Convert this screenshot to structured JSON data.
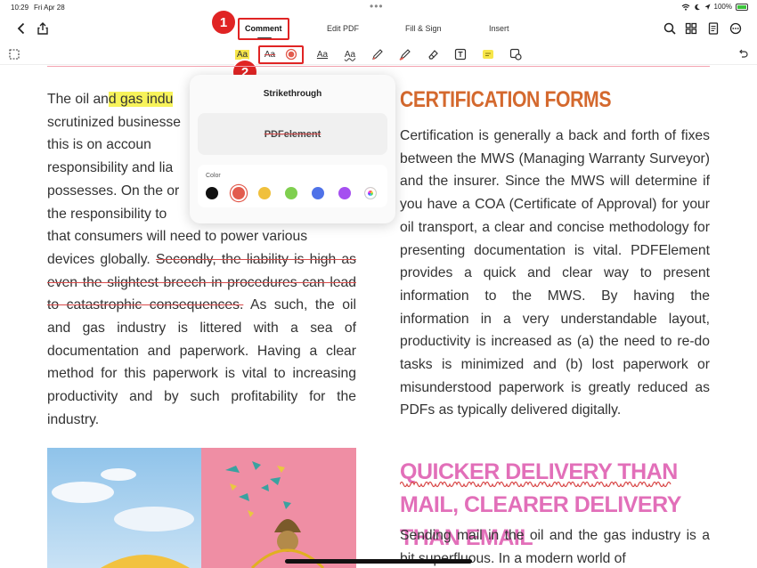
{
  "status": {
    "time": "10:29",
    "date": "Fri Apr 28",
    "battery": "100%"
  },
  "nav": {
    "tabs": [
      {
        "label": "Comment",
        "active": true
      },
      {
        "label": "Edit PDF"
      },
      {
        "label": "Fill & Sign"
      },
      {
        "label": "Insert"
      }
    ]
  },
  "callouts": {
    "one": "1",
    "two": "2"
  },
  "toolbar": {
    "tools": [
      "marquee-select-icon",
      "highlight-text-icon",
      "strikethrough-text-icon",
      "color-picker-icon",
      "underline-text-icon",
      "squiggly-text-icon",
      "pen-icon",
      "highlighter-pen-icon",
      "eraser-icon",
      "text-box-icon",
      "sticky-note-icon",
      "shape-icon",
      "undo-icon"
    ],
    "aa": "Aa"
  },
  "popover": {
    "title": "Strikethrough",
    "preview": "PDFelement",
    "color_label": "Color",
    "colors": [
      "#111111",
      "#e25c4e",
      "#f0c03c",
      "#7fcf4f",
      "#4f72e8",
      "#a54ff0",
      "multicolor"
    ]
  },
  "document": {
    "left": {
      "p1_a": "The oil an",
      "p1_hl": "d gas indu",
      "p1_b": "scrutinized businesse",
      "p1_c": "this is on accoun",
      "p1_d": "responsibility and lia",
      "p1_e": "possesses. On the or",
      "p1_f": "the responsibility to",
      "p1_g": "that consumers will need to power various",
      "p1_h": "devices globally.",
      "p1_strike": "Secondly, the liability is high as even the slightest breech in procedures can lead to catastrophic consequences.",
      "p1_i": "As such, the oil and gas industry is littered with a sea of documentation and paperwork. Having a clear method for this paperwork is vital to increasing productivity and by such profitability for the industry."
    },
    "right": {
      "heading1": "CERTIFICATION FORMS",
      "body1": "Certification is generally a back and forth of fixes between the MWS (Managing Warranty Surveyor) and the insurer. Since the MWS will determine if you have a COA (Certificate of Approval) for your oil transport, a clear and concise methodology for presenting documentation is vital. PDFElement provides a quick and clear way to present information to the MWS. By having the information in a very understandable layout, productivity is increased as (a) the need to re-do tasks is minimized and (b) lost paperwork or misunderstood paperwork is greatly reduced as PDFs as typically delivered digitally.",
      "heading2": "QUICKER DELIVERY THAN MAIL, CLEARER DELIVERY THAN EMAIL",
      "body2": "Sending mail in the oil and the gas industry is a bit superfluous. In a modern world of"
    }
  }
}
